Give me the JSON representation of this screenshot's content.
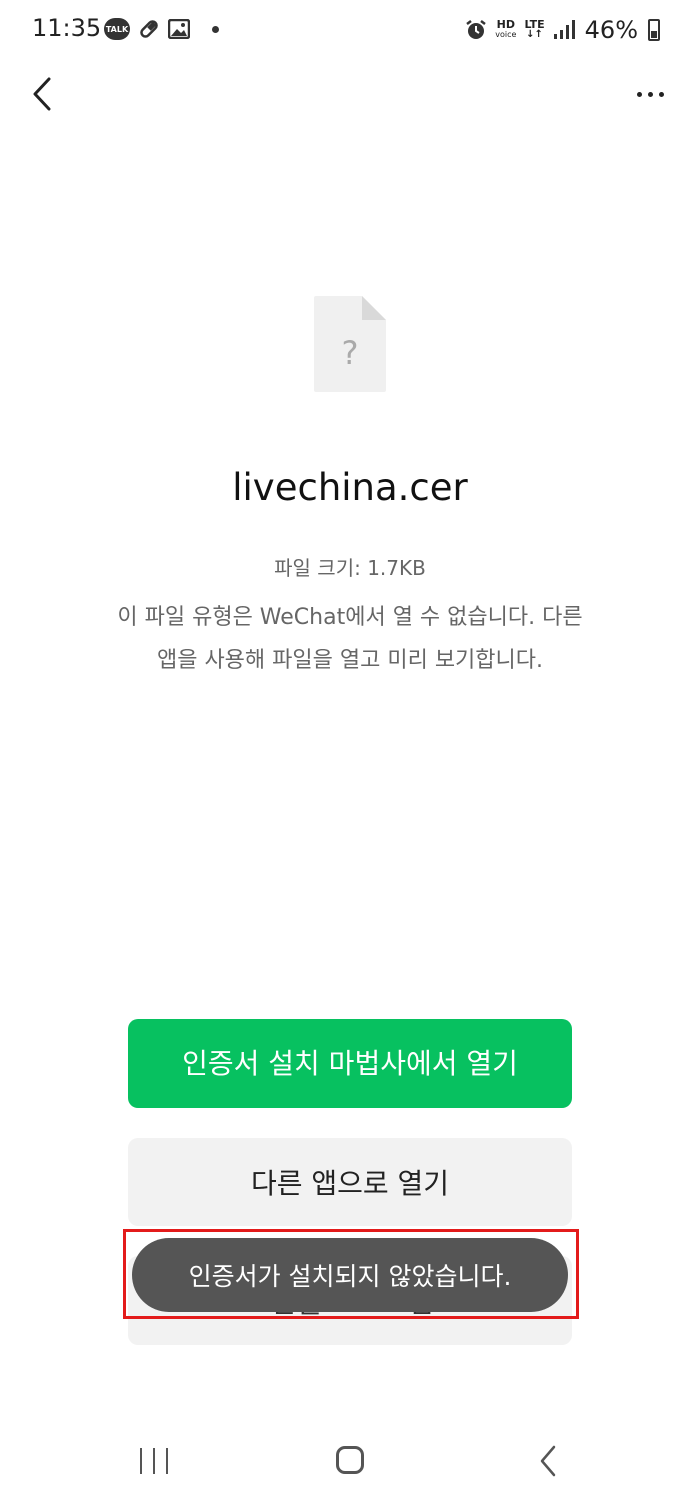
{
  "status_bar": {
    "time": "11:35",
    "talk_label": "TALK",
    "network_hd": "HD",
    "network_voice": "voice",
    "network_lte": "LTE",
    "battery": "46%"
  },
  "file": {
    "icon": "unknown-file-icon",
    "icon_glyph": "?",
    "name": "livechina.cer",
    "size": "파일 크기: 1.7KB",
    "message": "이 파일 유형은 WeChat에서 열 수 없습니다. 다른 앱을 사용해 파일을 열고 미리 보기합니다."
  },
  "actions": {
    "primary": "인증서 설치 마법사에서 열기",
    "secondary": "다른 앱으로 열기",
    "tertiary": "연결 프로그램..."
  },
  "toast": {
    "message": "인증서가 설치되지 않았습니다."
  },
  "colors": {
    "primary_button": "#07c160",
    "toast_background": "#555555",
    "highlight_border": "#e31b1b"
  }
}
